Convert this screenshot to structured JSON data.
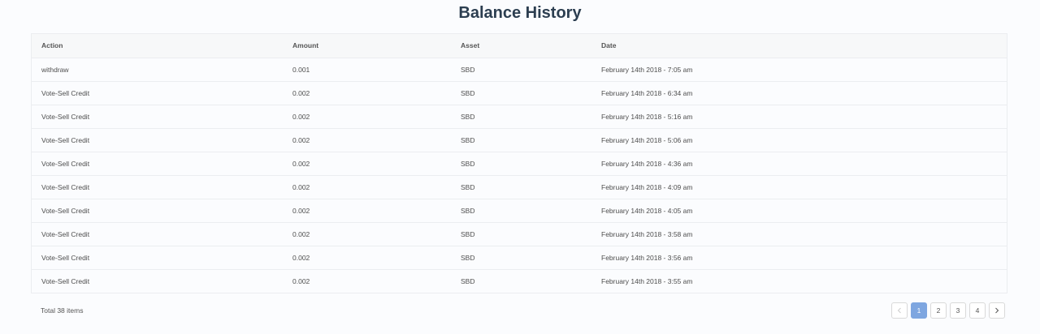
{
  "page": {
    "title": "Balance History"
  },
  "table": {
    "columns": [
      "Action",
      "Amount",
      "Asset",
      "Date"
    ],
    "rows": [
      [
        "withdraw",
        "0.001",
        "SBD",
        "February 14th 2018 - 7:05 am"
      ],
      [
        "Vote-Sell Credit",
        "0.002",
        "SBD",
        "February 14th 2018 - 6:34 am"
      ],
      [
        "Vote-Sell Credit",
        "0.002",
        "SBD",
        "February 14th 2018 - 5:16 am"
      ],
      [
        "Vote-Sell Credit",
        "0.002",
        "SBD",
        "February 14th 2018 - 5:06 am"
      ],
      [
        "Vote-Sell Credit",
        "0.002",
        "SBD",
        "February 14th 2018 - 4:36 am"
      ],
      [
        "Vote-Sell Credit",
        "0.002",
        "SBD",
        "February 14th 2018 - 4:09 am"
      ],
      [
        "Vote-Sell Credit",
        "0.002",
        "SBD",
        "February 14th 2018 - 4:05 am"
      ],
      [
        "Vote-Sell Credit",
        "0.002",
        "SBD",
        "February 14th 2018 - 3:58 am"
      ],
      [
        "Vote-Sell Credit",
        "0.002",
        "SBD",
        "February 14th 2018 - 3:56 am"
      ],
      [
        "Vote-Sell Credit",
        "0.002",
        "SBD",
        "February 14th 2018 - 3:55 am"
      ]
    ]
  },
  "footer": {
    "total_label": "Total 38 items"
  },
  "pagination": {
    "prev_icon": "chevron-left-icon",
    "next_icon": "chevron-right-icon",
    "pages": [
      "1",
      "2",
      "3",
      "4"
    ],
    "current_page": "1"
  },
  "colors": {
    "accent": "#7ea6e0",
    "title": "#2c3e50"
  }
}
